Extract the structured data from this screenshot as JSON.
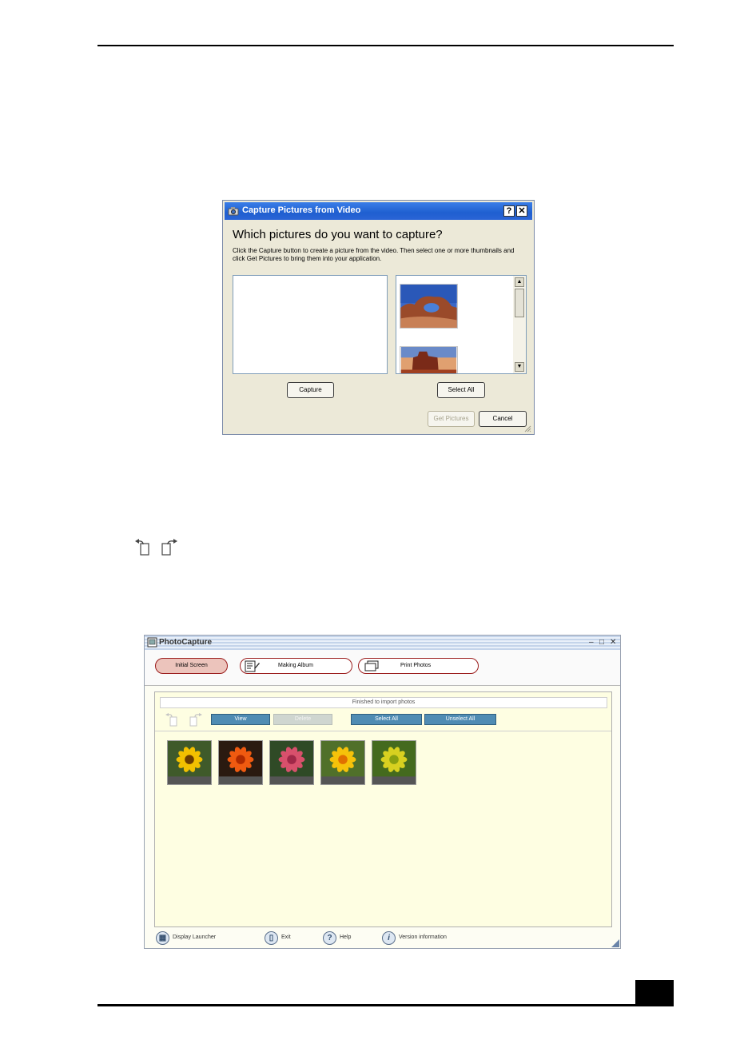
{
  "capture_dialog": {
    "title": "Capture Pictures from Video",
    "help_glyph": "?",
    "close_glyph": "✕",
    "heading": "Which pictures do you want to capture?",
    "instructions": "Click the Capture button to create a picture from the video. Then select one or more thumbnails and click Get Pictures to bring them into your application.",
    "capture_label": "Capture",
    "select_all_label": "Select All",
    "get_pictures_label": "Get Pictures",
    "cancel_label": "Cancel",
    "get_pictures_enabled": false
  },
  "rotate_icons": [
    "rotate-left-icon",
    "rotate-right-icon"
  ],
  "photocapture": {
    "title": "PhotoCapture",
    "window_controls": [
      "–",
      "□",
      "✕"
    ],
    "tabs": [
      {
        "label": "Initial Screen",
        "active": true
      },
      {
        "label": "Making Album",
        "active": false
      },
      {
        "label": "Print Photos",
        "active": false
      }
    ],
    "status": "Finished to import photos",
    "toolbar": {
      "view_label": "View",
      "delete_label": "Delete",
      "select_all_label": "Select All",
      "unselect_all_label": "Unselect All",
      "delete_enabled": false
    },
    "photos": [
      {
        "name": "yellow-daisy",
        "petal": "#f2c000",
        "center": "#6a3c00",
        "bg": "#3f5a2a"
      },
      {
        "name": "orange-leaves",
        "petal": "#f05a10",
        "center": "#b02a00",
        "bg": "#2a1a10"
      },
      {
        "name": "pink-rose",
        "petal": "#d8506c",
        "center": "#a02848",
        "bg": "#2f4a26"
      },
      {
        "name": "yellow-orange-flowers",
        "petal": "#f6c20a",
        "center": "#e07000",
        "bg": "#50702a"
      },
      {
        "name": "small-yellow-flowers",
        "petal": "#d8d020",
        "center": "#8aa010",
        "bg": "#446a1e"
      }
    ],
    "footer": [
      {
        "label": "Display Launcher",
        "icon": "launcher-icon",
        "glyph": "▦"
      },
      {
        "label": "Exit",
        "icon": "exit-icon",
        "glyph": "▯"
      },
      {
        "label": "Help",
        "icon": "help-icon",
        "glyph": "?"
      },
      {
        "label": "Version information",
        "icon": "info-icon",
        "glyph": "i"
      }
    ]
  },
  "colors": {
    "xp_title_blue": "#2a64d6",
    "xp_face": "#ece9d8",
    "pc_accent_red": "#9b1d1d",
    "pc_button_blue": "#4f8cb3",
    "pc_panel_yellow": "#fefee2"
  }
}
